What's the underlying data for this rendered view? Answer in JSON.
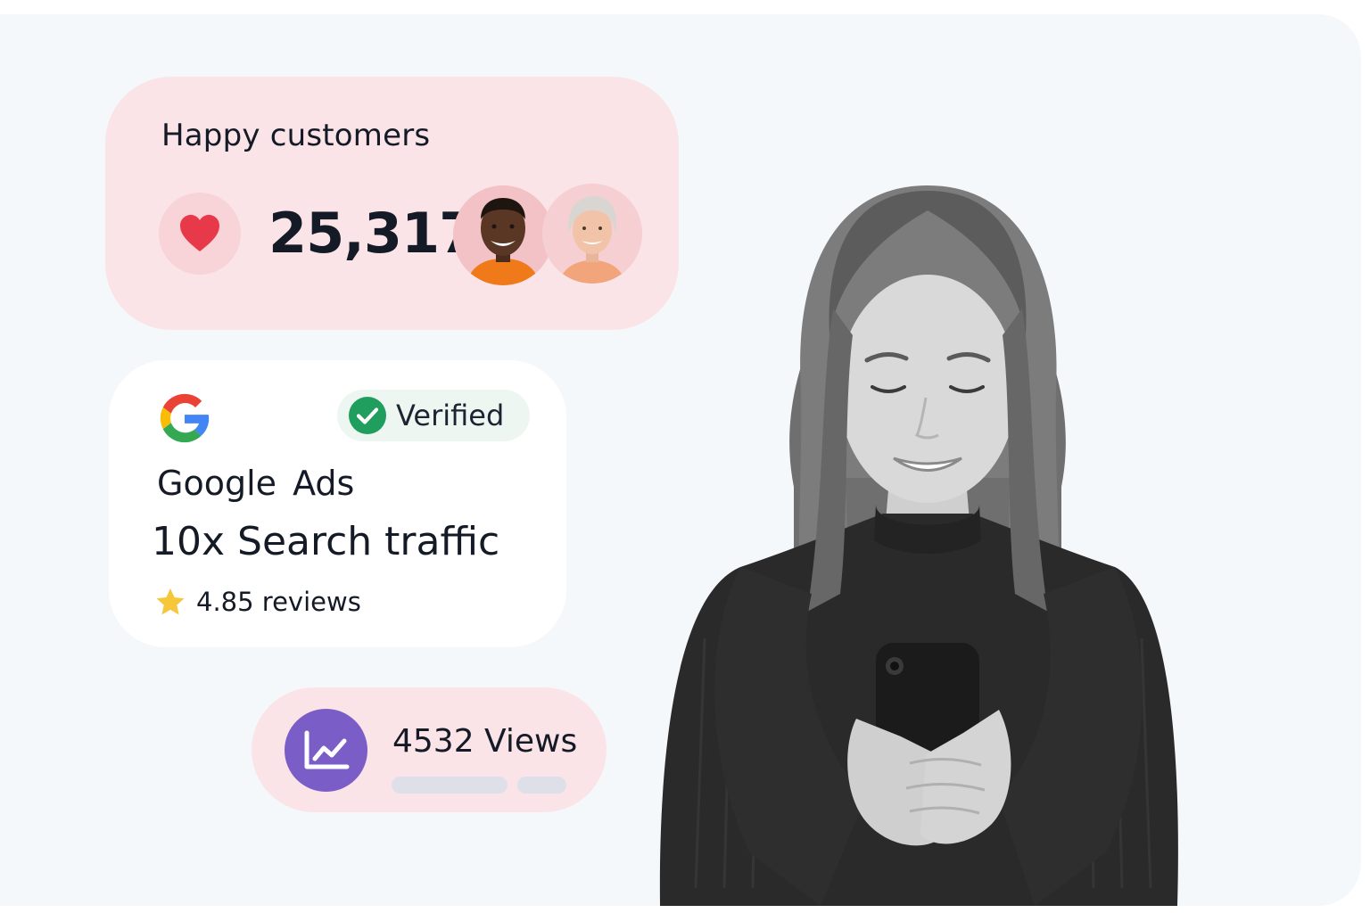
{
  "customers": {
    "title": "Happy customers",
    "count": "25,317",
    "icon": "heart-icon",
    "accent_color": "#e8394b"
  },
  "google": {
    "verified_label": "Verified",
    "name": "Google  Ads",
    "headline": "10x Search traffic",
    "reviews": "4.85 reviews",
    "logo_icon": "google-g-logo",
    "verified_icon": "check-circle-icon",
    "star_icon": "star-icon"
  },
  "views": {
    "label": "4532 Views",
    "icon": "trend-chart-icon",
    "icon_color": "#7a5dc7"
  }
}
